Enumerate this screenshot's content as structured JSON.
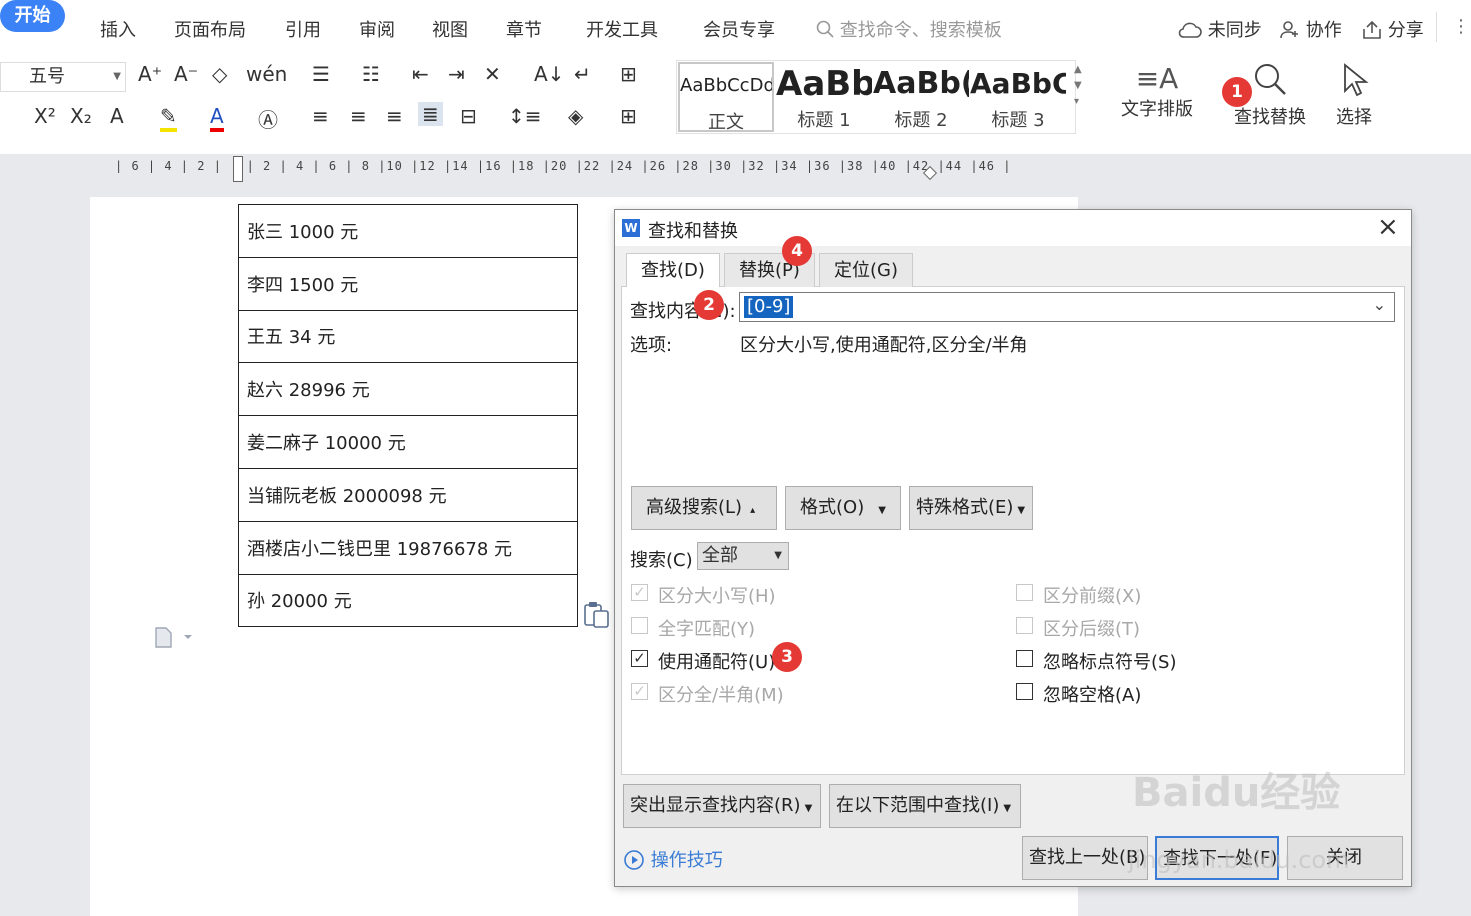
{
  "menubar": {
    "tabs": [
      "开始",
      "插入",
      "页面布局",
      "引用",
      "审阅",
      "视图",
      "章节",
      "开发工具",
      "会员专享"
    ],
    "search_placeholder": "查找命令、搜索模板",
    "right": [
      "未同步",
      "协作",
      "分享"
    ]
  },
  "toolbar": {
    "font_size": "五号",
    "styles": [
      {
        "preview": "AaBbCcDd",
        "label": "正文"
      },
      {
        "preview": "AaBb",
        "label": "标题 1"
      },
      {
        "preview": "AaBb(",
        "label": "标题 2"
      },
      {
        "preview": "AaBbC",
        "label": "标题 3"
      }
    ],
    "text_layout": "文字排版",
    "find_replace": "查找替换",
    "select": "选择"
  },
  "ruler": "| 6 | 4 | 2 |   | 2 | 4 | 6 | 8 |10 |12 |14 |16 |18 |20 |22 |24 |26 |28 |30 |32 |34 |36 |38 |40 |42 |44 |46 |",
  "document": {
    "rows": [
      "张三 1000 元",
      "李四 1500 元",
      "王五 34 元",
      "赵六 28996 元",
      "姜二麻子 10000 元",
      "当铺阮老板 2000098 元",
      "酒楼店小二钱巴里 19876678 元",
      "孙 20000 元"
    ]
  },
  "dialog": {
    "title": "查找和替换",
    "tabs": [
      "查找(D)",
      "替换(P)",
      "定位(G)"
    ],
    "find_label": "查找内容(N):",
    "find_value": "[0-9]",
    "options_label": "选项:",
    "options_value": "区分大小写,使用通配符,区分全/半角",
    "buttons": {
      "advanced": "高级搜索(L)",
      "format": "格式(O)",
      "special": "特殊格式(E)"
    },
    "search_label": "搜索(C)",
    "search_value": "全部",
    "checks_left": [
      {
        "label": "区分大小写(H)",
        "checked": true,
        "disabled": true
      },
      {
        "label": "全字匹配(Y)",
        "checked": false,
        "disabled": true
      },
      {
        "label": "使用通配符(U)",
        "checked": true,
        "disabled": false
      },
      {
        "label": "区分全/半角(M)",
        "checked": true,
        "disabled": true
      }
    ],
    "checks_right": [
      {
        "label": "区分前缀(X)",
        "checked": false,
        "disabled": true
      },
      {
        "label": "区分后缀(T)",
        "checked": false,
        "disabled": true
      },
      {
        "label": "忽略标点符号(S)",
        "checked": false,
        "disabled": false
      },
      {
        "label": "忽略空格(A)",
        "checked": false,
        "disabled": false
      }
    ],
    "highlight": "突出显示查找内容(R)",
    "find_in": "在以下范围中查找(I)",
    "tips": "操作技巧",
    "prev": "查找上一处(B)",
    "next": "查找下一处(F)",
    "close": "关闭"
  },
  "badges": [
    "1",
    "2",
    "3",
    "4"
  ],
  "watermark": {
    "brand": "Baidu经验",
    "url": "jingyan.baidu.com"
  }
}
